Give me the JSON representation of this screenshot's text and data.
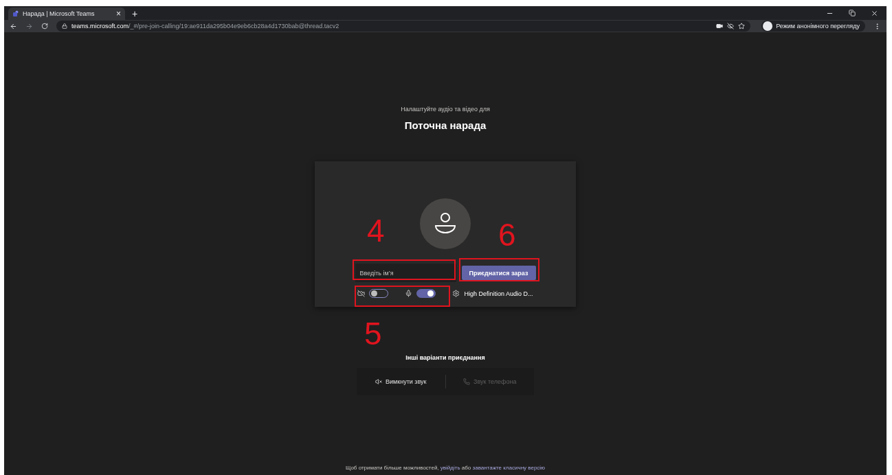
{
  "browser": {
    "tabs": [
      {
        "title": "Нарада | Microsoft Teams",
        "close": "×",
        "selected": true
      }
    ],
    "new_tab": "+",
    "url_host": "teams.microsoft.com",
    "url_path": "/_#/pre-join-calling/19:ae911da295b04e9eb6cb28a4d1730bab@thread.tacv2",
    "incognito_label": "Режим анонімного перегляду"
  },
  "prejoin": {
    "subtitle": "Налаштуйте аудіо та відео для",
    "title": "Поточна нарада",
    "name_field": {
      "placeholder": "Введіть ім’я"
    },
    "join_button": "Приєднатися зараз",
    "camera": {
      "on": false
    },
    "microphone": {
      "on": true
    },
    "audio_device": "High Definition Audio D...",
    "other_options_title": "Інші варіанти приєднання",
    "options": [
      {
        "label": "Вимкнути звук",
        "disabled": false
      },
      {
        "label": "Звук телефона",
        "disabled": true
      }
    ],
    "footer": {
      "text": "Щоб отримати більше можливостей, ",
      "sign_in": "увійдіть",
      "middle": " або ",
      "download": "завантажте класичну версію"
    }
  },
  "annotations": [
    {
      "label": "4"
    },
    {
      "label": "6"
    },
    {
      "label": "5"
    }
  ]
}
